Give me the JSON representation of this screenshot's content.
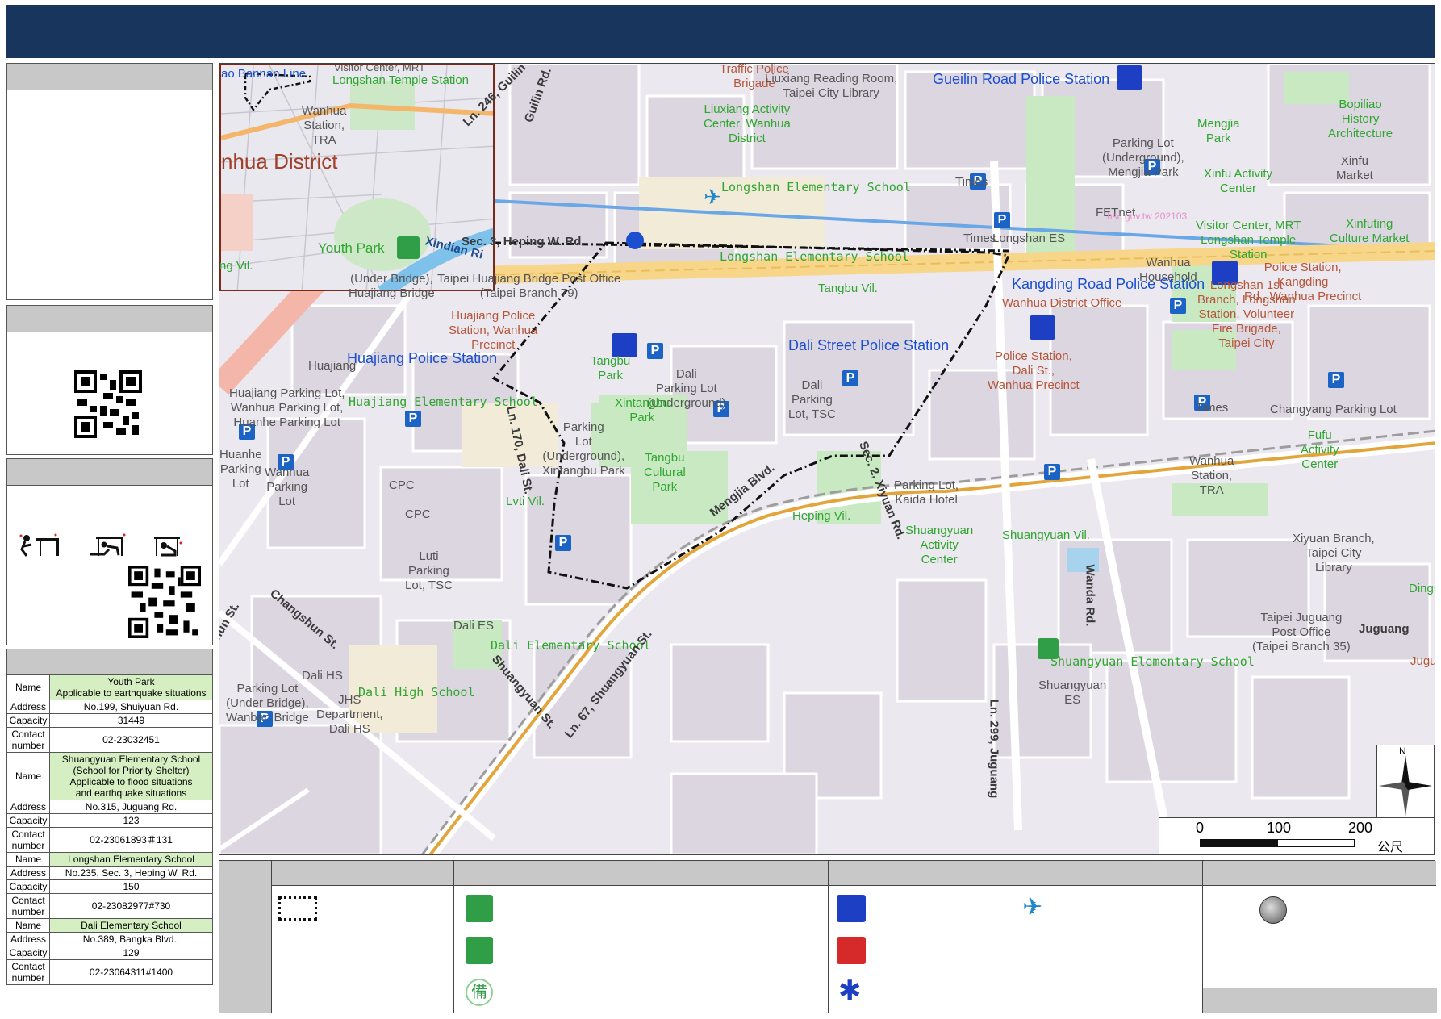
{
  "map": {
    "inset_labels": {
      "district": "nhua District",
      "mrt_top": "ao Bannan Line",
      "visitor": "Visitor Center, MRT",
      "longshan_temple": "Longshan Temple Station",
      "wanhua_station": "Wanhua\nStation,\nTRA",
      "youth_park": "Youth Park",
      "xindian": "Xindian Ri"
    },
    "place_labels": [
      {
        "t": "Traffic Police\nBrigade",
        "c": "red"
      },
      {
        "t": "Liuxiang Reading Room,\nTaipei City Library",
        "c": "grey"
      },
      {
        "t": "Liuxiang Activity\nCenter, Wanhua\nDistrict",
        "c": "green"
      },
      {
        "t": "Gueilin Road Police Station",
        "c": "blue"
      },
      {
        "t": "Bopiliao\nHistory\nArchitecture",
        "c": "green"
      },
      {
        "t": "Mengjia\nPark",
        "c": "green"
      },
      {
        "t": "Parking Lot\n(Underground),\nMengjia Park",
        "c": "grey"
      },
      {
        "t": "Xinfu\nMarket",
        "c": "grey"
      },
      {
        "t": "Xinfu Activity\nCenter",
        "c": "green"
      },
      {
        "t": "Visitor Center, MRT\nLongshan Temple\nStation",
        "c": "green"
      },
      {
        "t": "Xinfuting\nCulture Market",
        "c": "green"
      },
      {
        "t": "Longshan Elementary School",
        "c": "green"
      },
      {
        "t": "Times",
        "c": "grey"
      },
      {
        "t": "Times",
        "c": "grey"
      },
      {
        "t": "FETnet",
        "c": "grey"
      },
      {
        "t": "hsc.gov.tw 202103",
        "c": "pink"
      },
      {
        "t": "Longshan ES",
        "c": "grey"
      },
      {
        "t": "Sec. 3, Heping W. Rd.",
        "c": "street"
      },
      {
        "t": "Longshan Elementary School",
        "c": "green"
      },
      {
        "t": "Wanhua\nHousehold",
        "c": "grey"
      },
      {
        "t": "Police Station,\nKangding\nRd., Wanhua Precinct",
        "c": "red"
      },
      {
        "t": "Kangding Road Police Station",
        "c": "blue"
      },
      {
        "t": "Longshan 1st\nBranch, Longshan\nStation, Volunteer\nFire Brigade,\nTaipei City",
        "c": "red"
      },
      {
        "t": "Wanhua District Office",
        "c": "red"
      },
      {
        "t": "(Under Bridge),\nHuajiang Bridge",
        "c": "grey"
      },
      {
        "t": "Taipei Huajiang Bridge Post Office\n(Taipei Branch 79)",
        "c": "grey"
      },
      {
        "t": "Tangbu Vil.",
        "c": "green"
      },
      {
        "t": "Huajiang Police\nStation, Wanhua\nPrecinct",
        "c": "red"
      },
      {
        "t": "Huajiang Police Station",
        "c": "blue"
      },
      {
        "t": "Dali Street Police Station",
        "c": "blue"
      },
      {
        "t": "Police Station,\nDali St.,\nWanhua Precinct",
        "c": "red"
      },
      {
        "t": "Tangbu\nPark",
        "c": "green"
      },
      {
        "t": "Dali\nParking Lot\n(Underground)",
        "c": "grey"
      },
      {
        "t": "Huajiang",
        "c": "grey"
      },
      {
        "t": "Huajiang Parking Lot,\nWanhua Parking Lot,\nHuanhe Parking Lot",
        "c": "grey"
      },
      {
        "t": "Huajiang Elementary School",
        "c": "green"
      },
      {
        "t": "Xintangbu\nPark",
        "c": "green"
      },
      {
        "t": "Dali\nParking\nLot, TSC",
        "c": "grey"
      },
      {
        "t": "Times",
        "c": "grey"
      },
      {
        "t": "Changyang Parking Lot",
        "c": "grey"
      },
      {
        "t": "Fufu\nActivity\nCenter",
        "c": "green"
      },
      {
        "t": "Parking\nLot\n(Underground),\nXintangbu Park",
        "c": "grey"
      },
      {
        "t": "Tangbu\nCultural\nPark",
        "c": "green"
      },
      {
        "t": "Huanhe\nParking\nLot",
        "c": "grey"
      },
      {
        "t": "Wanhua\nParking\nLot",
        "c": "grey"
      },
      {
        "t": "CPC",
        "c": "grey"
      },
      {
        "t": "CPC",
        "c": "grey"
      },
      {
        "t": "Lvti Vil.",
        "c": "green"
      },
      {
        "t": "Wanhua\nStation,\nTRA",
        "c": "grey"
      },
      {
        "t": "Parking Lot,\nKaida Hotel",
        "c": "grey"
      },
      {
        "t": "Heping Vil.",
        "c": "green"
      },
      {
        "t": "Shuangyuan\nActivity\nCenter",
        "c": "green"
      },
      {
        "t": "Shuangyuan Vil.",
        "c": "green"
      },
      {
        "t": "Xiyuan Branch,\nTaipei City\nLibrary",
        "c": "grey"
      },
      {
        "t": "Dings",
        "c": "green"
      },
      {
        "t": "Luti\nParking\nLot, TSC",
        "c": "grey"
      },
      {
        "t": "Dali ES",
        "c": "grey"
      },
      {
        "t": "Dali Elementary School",
        "c": "green"
      },
      {
        "t": "Taipei Juguang\nPost Office\n(Taipei Branch 35)",
        "c": "grey"
      },
      {
        "t": "Juguang",
        "c": "street"
      },
      {
        "t": "Jugu",
        "c": "red"
      },
      {
        "t": "Shuangyuan Elementary School",
        "c": "green"
      },
      {
        "t": "Shuangyuan\nES",
        "c": "grey"
      },
      {
        "t": "Dali HS",
        "c": "grey"
      },
      {
        "t": "Dali High School",
        "c": "green"
      },
      {
        "t": "Parking Lot\n(Under Bridge),\nWanban Bridge",
        "c": "grey"
      },
      {
        "t": "JHS\nDepartment,\nDali HS",
        "c": "grey"
      },
      {
        "t": "ng Vil.",
        "c": "green"
      }
    ],
    "street_labels": [
      "Ln. 246, Guilin",
      "Guilin Rd.",
      "Xindian Ri",
      "Ln. 170, Dali St.",
      "Mengjia Blvd.",
      "Sec. 2, Xiyuan Rd.",
      "Changshun St.",
      "gshun St.",
      "Shuangyuan St.",
      "Ln. 67, Shuangyuan St.",
      "Wanda Rd.",
      "Ln. 299, Juguang"
    ],
    "scale": {
      "t0": "0",
      "t1": "100",
      "t2": "200",
      "unit": "公尺"
    },
    "compass_n": "N"
  },
  "shelters": [
    {
      "name": "Youth Park\nApplicable to earthquake situations",
      "address": "No.199, Shuiyuan Rd.",
      "capacity": "31449",
      "contact": "02-23032451"
    },
    {
      "name": "Shuangyuan Elementary School\n(School for Priority Shelter)\nApplicable to flood situations\nand earthquake situations",
      "address": "No.315, Juguang Rd.",
      "capacity": "123",
      "contact": "02-23061893＃131"
    },
    {
      "name": "Longshan Elementary School",
      "address": "No.235, Sec. 3, Heping W. Rd.",
      "capacity": "150",
      "contact": "02-23082977#730"
    },
    {
      "name": "Dali Elementary School",
      "address": "No.389, Bangka Blvd.,",
      "capacity": "129",
      "contact": "02-23064311#1400"
    }
  ],
  "table_keys": {
    "name": "Name",
    "address": "Address",
    "capacity": "Capacity",
    "contact": "Contact\nnumber"
  },
  "legend_icons": {
    "boundary": "dotted-boundary-icon",
    "shelter": "shelter-icon",
    "park": "park-icon",
    "reserve": "reserve-icon",
    "police": "police-icon",
    "fire": "fire-icon",
    "medical": "medical-icon",
    "heli": "helicopter-icon",
    "circle": "grey-circle-icon"
  },
  "reserve_char": "備"
}
